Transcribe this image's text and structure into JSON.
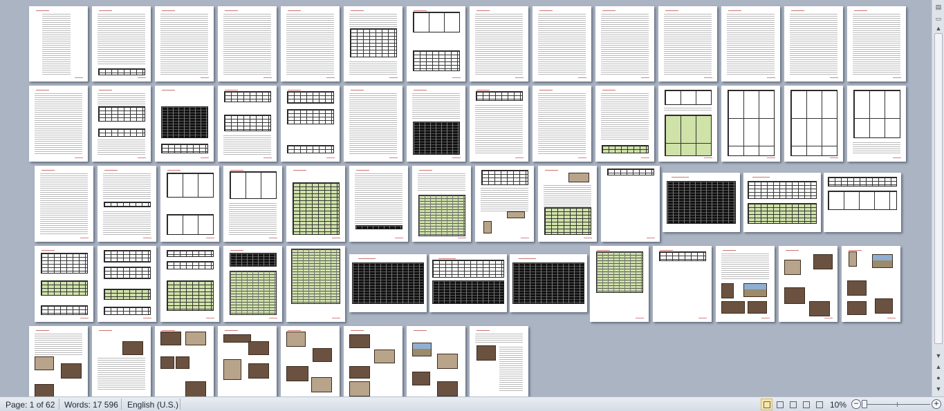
{
  "statusbar": {
    "page": "Page: 1 of 62",
    "words": "Words: 17 596",
    "language": "English (U.S.)",
    "zoom": "10%"
  },
  "icons": {
    "view_print_layout": "print-layout-icon",
    "view_full_screen": "full-screen-reading-icon",
    "view_web": "web-layout-icon",
    "view_outline": "outline-icon",
    "view_draft": "draft-icon"
  },
  "colors": {
    "workspace": "#abb4c2",
    "header_rule": "#c0504d",
    "table_fill": "#cfe2a8"
  }
}
